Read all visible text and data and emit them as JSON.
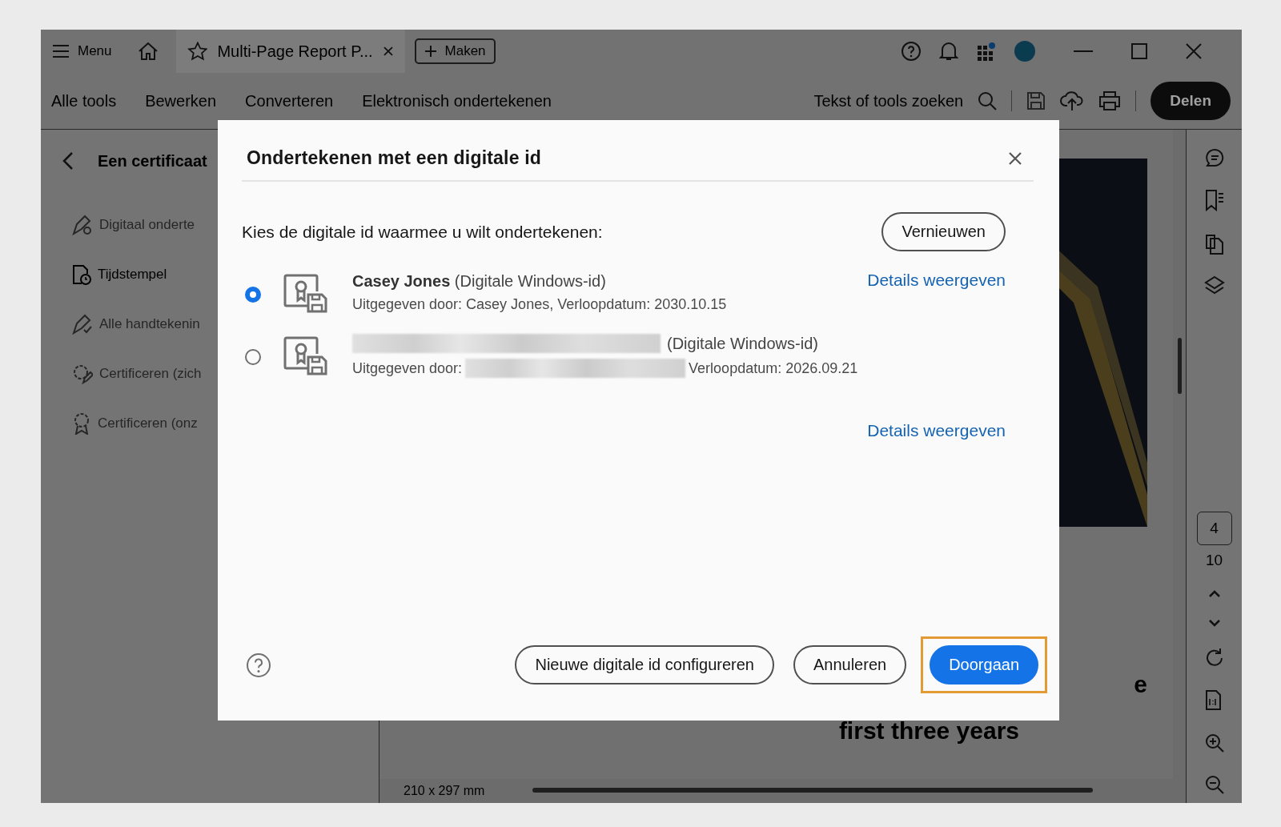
{
  "titlebar": {
    "menu": "Menu",
    "tab": "Multi-Page Report P...",
    "create": "Maken"
  },
  "toolbar": {
    "items": [
      {
        "label": "Alle tools"
      },
      {
        "label": "Bewerken"
      },
      {
        "label": "Converteren"
      },
      {
        "label": "Elektronisch ondertekenen"
      }
    ],
    "search": "Tekst of tools zoeken",
    "share": "Delen"
  },
  "panel": {
    "title": "Een certificaat",
    "items": [
      {
        "label": "Digitaal onderte",
        "disabled": true
      },
      {
        "label": "Tijdstempel",
        "disabled": false
      },
      {
        "label": "Alle handtekenin",
        "disabled": true
      },
      {
        "label": "Certificeren (zich",
        "disabled": true
      },
      {
        "label": "Certificeren (onz",
        "disabled": true
      }
    ]
  },
  "document": {
    "heading_end": "e",
    "subheading": "first three years",
    "page_size": "210 x 297 mm"
  },
  "rail": {
    "page": "4",
    "total": "10"
  },
  "dialog": {
    "title": "Ondertekenen met een digitale id",
    "prompt": "Kies de digitale id waarmee u wilt ondertekenen:",
    "refresh": "Vernieuwen",
    "ids": [
      {
        "selected": true,
        "redacted": false,
        "title": "**Casey Jones** (Digitale Windows-id)",
        "issued": [
          "Uitgegeven door: Casey Jones, Verloopdatum: 2030.10.15"
        ],
        "details": "Details weergeven"
      },
      {
        "selected": false,
        "redacted": true,
        "title": "(Digitale Windows-id)",
        "issued": [
          "Uitgegeven door:",
          "Verloopdatum: 2026.09.21"
        ]
      }
    ],
    "details_link": "Details weergeven",
    "buttons": [
      {
        "label": "Nieuwe digitale id configureren",
        "primary": false,
        "highlighted": false
      },
      {
        "label": "Annuleren",
        "primary": false,
        "highlighted": false
      },
      {
        "label": "Doorgaan",
        "primary": true,
        "highlighted": true
      }
    ]
  }
}
